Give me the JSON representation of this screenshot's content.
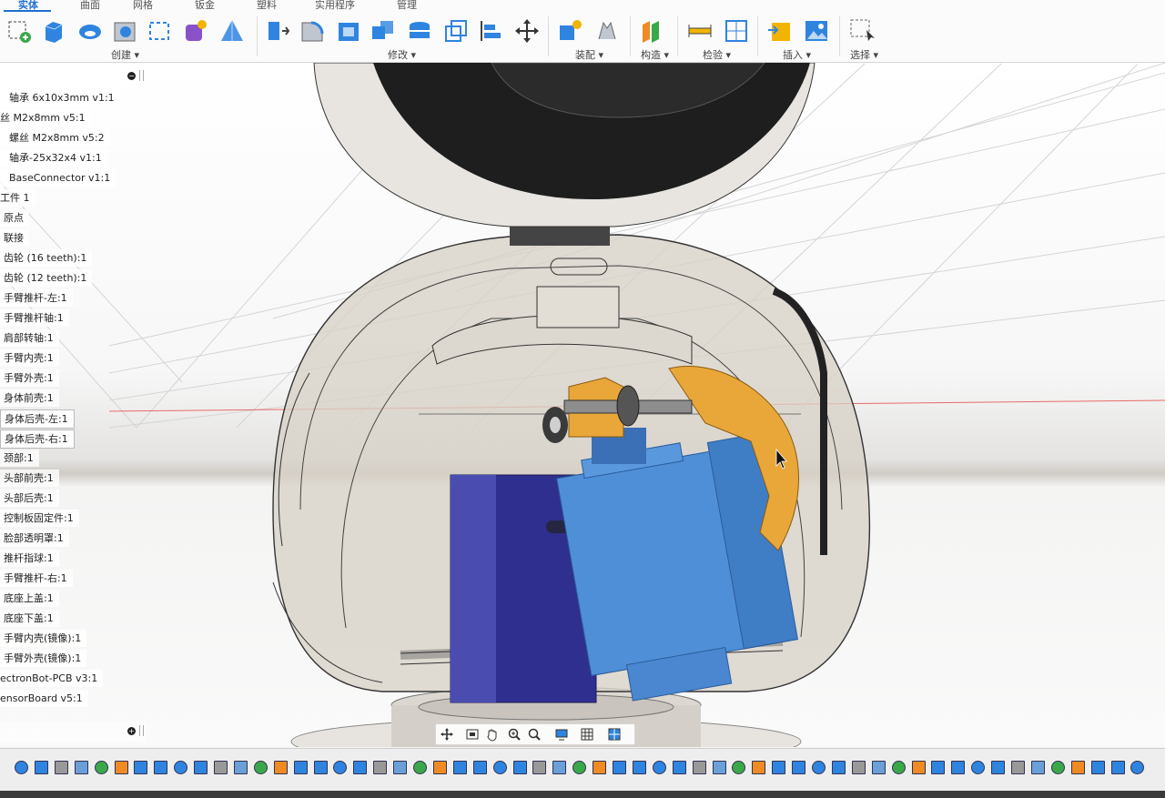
{
  "ribbon": {
    "tabs": [
      "实体",
      "曲面",
      "网格",
      "钣金",
      "塑料",
      "实用程序",
      "管理"
    ],
    "active_tab": "实体",
    "groups": {
      "create": "创建 ▾",
      "modify": "修改 ▾",
      "assemble": "装配 ▾",
      "construct": "构造 ▾",
      "inspect": "检验 ▾",
      "insert": "插入 ▾",
      "select": "选择 ▾"
    }
  },
  "browser": {
    "items": [
      "轴承 6x10x3mm v1:1",
      "丝 M2x8mm v5:1",
      "螺丝 M2x8mm v5:2",
      "轴承-25x32x4 v1:1",
      "BaseConnector v1:1",
      "工件 1",
      "原点",
      "联接",
      "齿轮 (16 teeth):1",
      "齿轮 (12 teeth):1",
      "手臂推杆-左:1",
      "手臂推杆轴:1",
      "肩部转轴:1",
      "手臂内壳:1",
      "手臂外壳:1",
      "身体前壳:1",
      "身体后壳-左:1",
      "身体后壳-右:1",
      "颈部:1",
      "头部前壳:1",
      "头部后壳:1",
      "控制板固定件:1",
      "脸部透明罩:1",
      "推杆指球:1",
      "手臂推杆-右:1",
      "底座上盖:1",
      "底座下盖:1",
      "手臂内壳(镜像):1",
      "手臂外壳(镜像):1",
      "ectronBot-PCB v3:1",
      "ensorBoard v5:1"
    ]
  },
  "colors": {
    "accent": "#1f6fd1",
    "shell": "#dcd6cc",
    "servo_blue": "#4f8fd8",
    "servo_dark": "#2e2f8e",
    "gear_orange": "#e9a73a"
  }
}
